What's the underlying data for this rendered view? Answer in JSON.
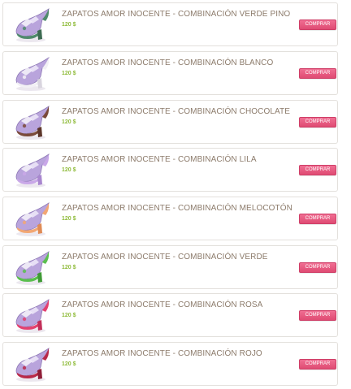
{
  "products": [
    {
      "title": "ZAPATOS AMOR iNOCENTE - COMBiNACIÓN VERDE PiNO",
      "price": "120 $",
      "button": "COMPRAR",
      "accent": "#4f8a6c",
      "sole": "#3d6b52"
    },
    {
      "title": "ZAPATOS AMOR iNOCENTE - COMBiNACIÓN BLANCO",
      "price": "120 $",
      "button": "COMPRAR",
      "accent": "#f2f0f5",
      "sole": "#d9d5df"
    },
    {
      "title": "ZAPATOS AMOR iNOCENTE - COMBiNACIÓN CHOCOLATE",
      "price": "120 $",
      "button": "COMPRAR",
      "accent": "#7a4a3a",
      "sole": "#5c352a"
    },
    {
      "title": "ZAPATOS AMOR iNOCENTE - COMBiNACIÓN LiLA",
      "price": "120 $",
      "button": "COMPRAR",
      "accent": "#c9a8e8",
      "sole": "#a987cf"
    },
    {
      "title": "ZAPATOS AMOR iNOCENTE - COMBiNACIÓN MELOCOTÓN",
      "price": "120 $",
      "button": "COMPRAR",
      "accent": "#f2a774",
      "sole": "#e08b55"
    },
    {
      "title": "ZAPATOS AMOR iNOCENTE - COMBiNACIÓN VERDE",
      "price": "120 $",
      "button": "COMPRAR",
      "accent": "#5bbf4f",
      "sole": "#3f9a35"
    },
    {
      "title": "ZAPATOS AMOR iNOCENTE - COMBiNACIÓN ROSA",
      "price": "120 $",
      "button": "COMPRAR",
      "accent": "#e3416f",
      "sole": "#c22f59"
    },
    {
      "title": "ZAPATOS AMOR iNOCENTE - COMBiNACIÓN ROJO",
      "price": "120 $",
      "button": "COMPRAR",
      "accent": "#b82a4a",
      "sole": "#8f1e38"
    }
  ],
  "colors": {
    "title": "#8c7b6b",
    "price": "#8fbb3a",
    "button": "#e9587f",
    "shoe_main": "#b9a4dc"
  },
  "icons": {
    "thumbnail": "shoe-icon"
  }
}
